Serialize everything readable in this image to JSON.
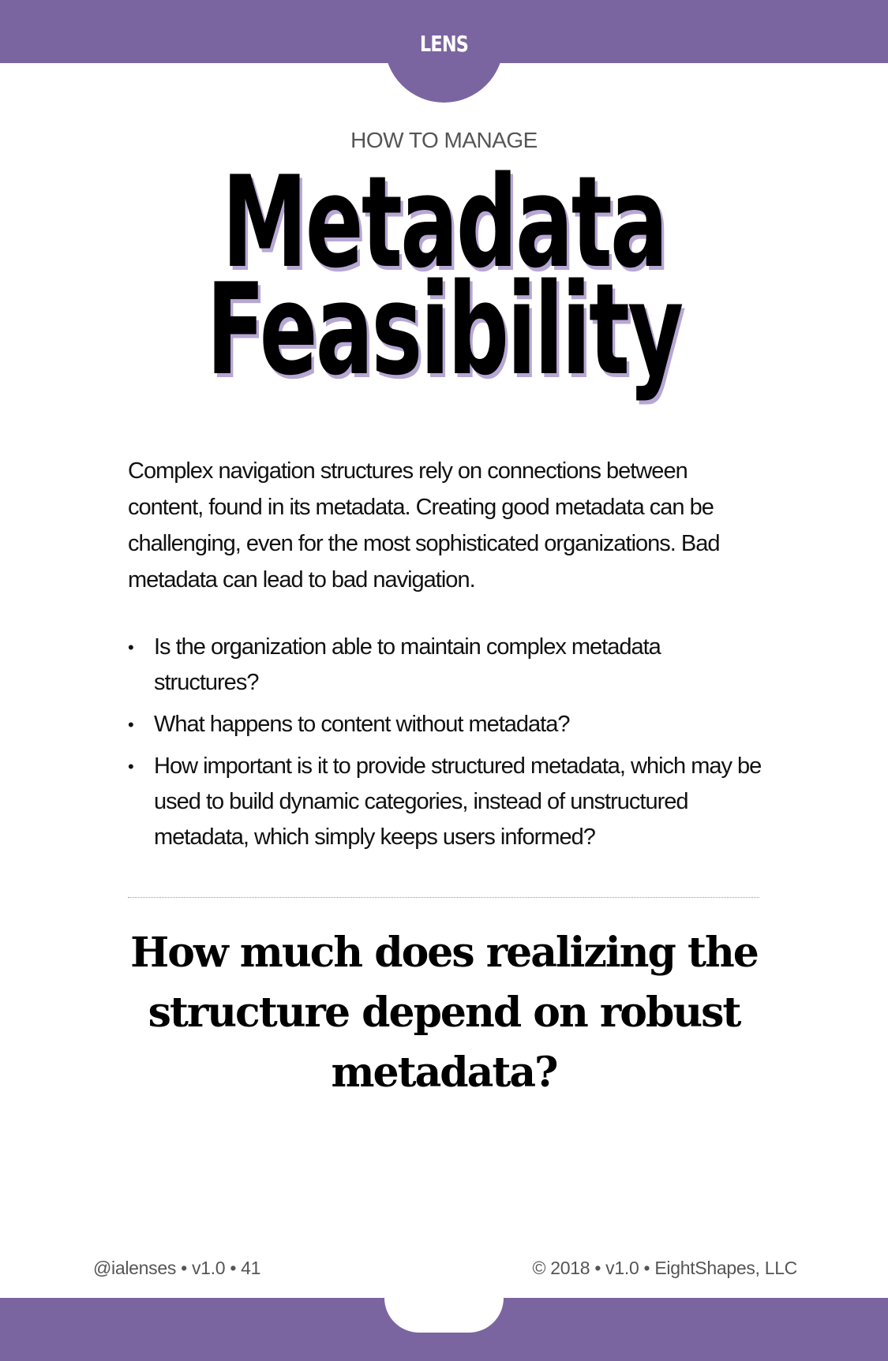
{
  "header": {
    "badge": "LENS"
  },
  "card": {
    "overline": "HOW TO MANAGE",
    "title_line1": "Metadata",
    "title_line2": "Feasibility",
    "intro": "Complex navigation structures rely on connections between content, found in its metadata. Creating good metadata can be challenging, even for the most sophisticated organizations. Bad metadata can lead to bad navigation.",
    "bullets": [
      "Is the organization able to maintain complex metadata structures?",
      "What happens to content without metadata?",
      "How important is it to provide structured metadata, which may be used to build dynamic categories, instead of unstructured metadata, which simply keeps users informed?"
    ],
    "bullet_symbol": "•",
    "question": "How much does realizing the structure depend on robust metadata?"
  },
  "footer": {
    "left": "@ialenses • v1.0 •  41",
    "right": "© 2018 • v1.0 • EightShapes, LLC"
  },
  "colors": {
    "brand_purple": "#7b65a0",
    "title_shadow": "#b7a7d4"
  }
}
